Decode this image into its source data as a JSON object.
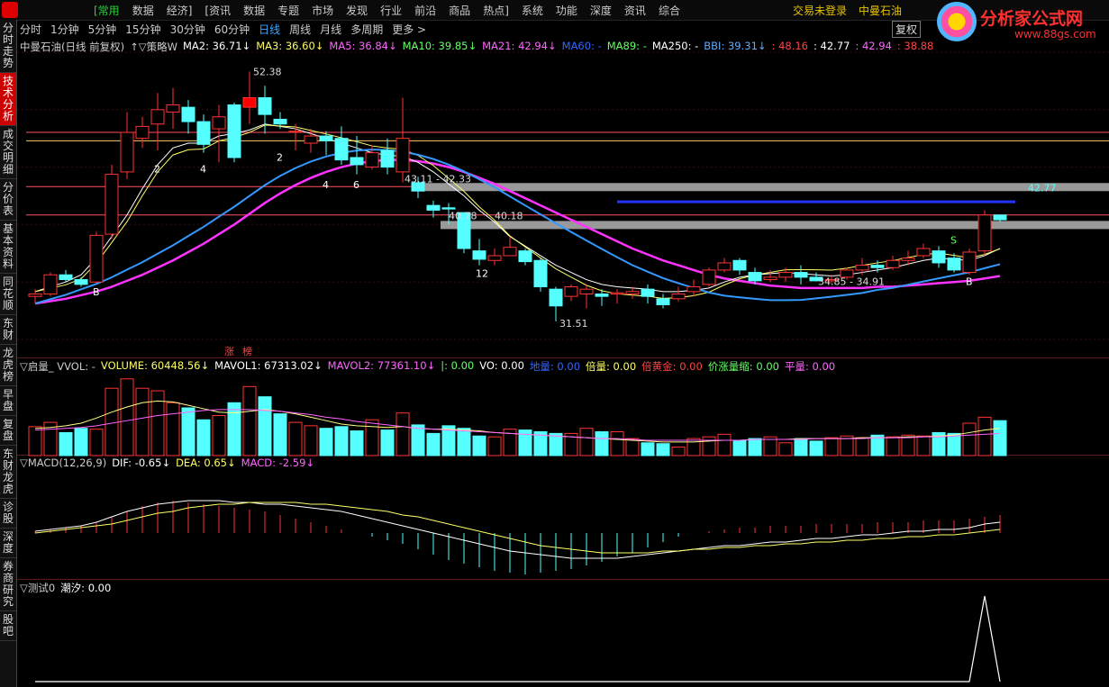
{
  "app": {
    "menu": [
      "[常用",
      "数据",
      "经济]",
      "[资讯",
      "数据",
      "专题",
      "市场",
      "发现",
      "行业",
      "前沿",
      "商品",
      "热点]",
      "系统",
      "功能",
      "深度",
      "资讯",
      "综合"
    ],
    "login": "交易未登录",
    "stock_name": "中曼石油",
    "brand_name": "分析家公式网",
    "brand_url": "www.88gs.com"
  },
  "sidebar": [
    "分时走势",
    "技术分析",
    "成交明细",
    "分价表",
    "基本资料",
    "同花顺",
    "东财",
    "龙虎榜",
    "早盘",
    "复盘",
    "东财龙虎",
    "诊股",
    "深度",
    "券商研究",
    "股吧"
  ],
  "periods": [
    "分时",
    "1分钟",
    "5分钟",
    "15分钟",
    "30分钟",
    "60分钟",
    "日线",
    "周线",
    "月线",
    "多周期",
    "更多 >"
  ],
  "active_period": "日线",
  "fuquan_label": "复权",
  "main_legend": [
    {
      "t": "中曼石油(日线 前复权)",
      "c": "#cccccc"
    },
    {
      "t": "↑▽策略W",
      "c": "#cccccc"
    },
    {
      "t": "MA2: 36.71↓",
      "c": "#ffffff"
    },
    {
      "t": "MA3: 36.60↓",
      "c": "#ffff66"
    },
    {
      "t": "MA5: 36.84↓",
      "c": "#ff66ff"
    },
    {
      "t": "MA10: 39.85↓",
      "c": "#66ff66"
    },
    {
      "t": "MA21: 42.94↓",
      "c": "#ff66ff"
    },
    {
      "t": "MA60: -",
      "c": "#3366ff"
    },
    {
      "t": "MA89: -",
      "c": "#66ff66"
    },
    {
      "t": "MA250: -",
      "c": "#ffffff"
    },
    {
      "t": "BBI: 39.31↓",
      "c": "#66aaff"
    },
    {
      "t": ": 48.16",
      "c": "#ff4444"
    },
    {
      "t": ": 42.77",
      "c": "#ffffff"
    },
    {
      "t": ": 42.94",
      "c": "#ff66ff"
    },
    {
      "t": ": 38.88",
      "c": "#ff4444"
    }
  ],
  "vol_legend": [
    {
      "t": "▽启量_ VVOL: -",
      "c": "#cccccc"
    },
    {
      "t": "VOLUME: 60448.56↓",
      "c": "#ffff66"
    },
    {
      "t": "MAVOL1: 67313.02↓",
      "c": "#ffffff"
    },
    {
      "t": "MAVOL2: 77361.10↓",
      "c": "#ff66ff"
    },
    {
      "t": "|: 0.00",
      "c": "#66ff66"
    },
    {
      "t": "VO: 0.00",
      "c": "#ffffff"
    },
    {
      "t": "地量: 0.00",
      "c": "#3366ff"
    },
    {
      "t": "倍量: 0.00",
      "c": "#ffff66"
    },
    {
      "t": "倍黄金: 0.00",
      "c": "#ff4444"
    },
    {
      "t": "价涨量缩: 0.00",
      "c": "#66ff66"
    },
    {
      "t": "平量: 0.00",
      "c": "#ff66ff"
    }
  ],
  "macd_legend": [
    {
      "t": "▽MACD(12,26,9)",
      "c": "#cccccc"
    },
    {
      "t": "DIF: -0.65↓",
      "c": "#ffffff"
    },
    {
      "t": "DEA: 0.65↓",
      "c": "#ffff66"
    },
    {
      "t": "MACD: -2.59↓",
      "c": "#ff66ff"
    }
  ],
  "test_legend": [
    {
      "t": "▽测试0",
      "c": "#cccccc"
    },
    {
      "t": "潮汐: 0.00",
      "c": "#ffffff"
    }
  ],
  "annotations": [
    "52.38",
    "43.11 - 42.33",
    "40.78",
    "40.18",
    "31.51",
    "34.85 - 34.91",
    "42.77",
    "2",
    "4",
    "2",
    "4",
    "6",
    "12",
    "B",
    "S",
    "B"
  ],
  "limit_up_labels": [
    "涨",
    "榜"
  ],
  "chart_data": [
    {
      "type": "candlestick",
      "title": "中曼石油(日线 前复权)",
      "ylim": [
        30,
        54
      ],
      "candles": [
        [
          33.6,
          33.8,
          33.0,
          34.2
        ],
        [
          33.8,
          35.4,
          33.6,
          35.6
        ],
        [
          35.4,
          35.0,
          34.8,
          35.8
        ],
        [
          35.0,
          34.6,
          34.4,
          35.2
        ],
        [
          34.8,
          38.7,
          34.7,
          39.0
        ],
        [
          38.8,
          43.8,
          38.4,
          44.6
        ],
        [
          44.0,
          47.3,
          43.4,
          49.0
        ],
        [
          46.8,
          47.8,
          46.0,
          48.6
        ],
        [
          48.0,
          49.2,
          45.8,
          50.6
        ],
        [
          49.0,
          49.6,
          47.6,
          51.0
        ],
        [
          49.4,
          48.2,
          47.2,
          50.0
        ],
        [
          48.2,
          46.3,
          45.6,
          48.8
        ],
        [
          47.6,
          48.6,
          44.8,
          49.6
        ],
        [
          49.6,
          45.2,
          44.8,
          49.8
        ],
        [
          49.4,
          50.2,
          48.0,
          52.38
        ],
        [
          50.2,
          48.8,
          47.2,
          51.2
        ],
        [
          48.4,
          48.0,
          47.6,
          49.0
        ],
        [
          47.4,
          47.4,
          45.8,
          48.0
        ],
        [
          46.4,
          47.0,
          45.6,
          47.6
        ],
        [
          47.0,
          46.6,
          45.4,
          47.4
        ],
        [
          46.8,
          45.0,
          44.6,
          47.8
        ],
        [
          45.2,
          44.6,
          43.8,
          47.0
        ],
        [
          44.4,
          45.6,
          44.2,
          46.2
        ],
        [
          45.8,
          44.4,
          43.8,
          46.8
        ],
        [
          44.0,
          46.8,
          43.11,
          50.2
        ],
        [
          43.1,
          42.4,
          41.8,
          43.6
        ],
        [
          41.2,
          40.8,
          40.18,
          41.6
        ],
        [
          41.0,
          40.9,
          39.6,
          41.4
        ],
        [
          40.6,
          37.6,
          37.2,
          40.6
        ],
        [
          37.4,
          36.7,
          36.2,
          38.4
        ],
        [
          36.6,
          37.0,
          36.2,
          37.6
        ],
        [
          37.0,
          37.7,
          37.0,
          38.6
        ],
        [
          37.4,
          36.5,
          36.2,
          37.6
        ],
        [
          36.6,
          34.4,
          34.0,
          36.8
        ],
        [
          34.2,
          32.8,
          31.51,
          34.4
        ],
        [
          33.6,
          34.4,
          33.2,
          34.6
        ],
        [
          33.8,
          34.2,
          32.6,
          34.6
        ],
        [
          33.8,
          33.6,
          32.8,
          34.2
        ],
        [
          33.8,
          33.9,
          33.0,
          34.2
        ],
        [
          33.8,
          34.0,
          33.4,
          34.4
        ],
        [
          34.2,
          33.6,
          33.0,
          34.6
        ],
        [
          33.4,
          32.9,
          32.6,
          33.8
        ],
        [
          33.4,
          33.8,
          33.2,
          34.4
        ],
        [
          34.0,
          34.4,
          33.6,
          35.0
        ],
        [
          34.6,
          35.8,
          34.4,
          36.0
        ],
        [
          35.8,
          36.4,
          35.6,
          36.8
        ],
        [
          36.6,
          35.8,
          35.4,
          36.8
        ],
        [
          35.6,
          34.9,
          34.6,
          36.0
        ],
        [
          35.0,
          35.2,
          34.8,
          35.8
        ],
        [
          35.2,
          35.6,
          34.8,
          36.0
        ],
        [
          35.6,
          35.2,
          34.6,
          36.2
        ],
        [
          35.2,
          34.9,
          34.85,
          35.6
        ],
        [
          34.9,
          35.0,
          34.7,
          35.4
        ],
        [
          35.2,
          35.8,
          35.0,
          36.0
        ],
        [
          35.8,
          36.2,
          35.4,
          36.8
        ],
        [
          36.2,
          36.0,
          35.6,
          36.6
        ],
        [
          36.0,
          36.6,
          35.8,
          37.0
        ],
        [
          36.6,
          36.8,
          36.2,
          37.4
        ],
        [
          37.0,
          37.6,
          36.8,
          38.0
        ],
        [
          37.4,
          36.4,
          36.0,
          37.8
        ],
        [
          36.8,
          35.8,
          35.6,
          37.2
        ],
        [
          35.6,
          37.3,
          35.4,
          37.6
        ],
        [
          37.4,
          40.4,
          37.0,
          40.8
        ],
        [
          40.4,
          40.0,
          39.8,
          40.4
        ]
      ],
      "limit_levels": [
        47.3,
        46.6,
        42.77,
        40.4
      ],
      "ma_points": {
        "MA5": [
          34.0,
          34.4,
          34.8,
          35.4,
          36.8,
          38.6,
          40.4,
          42.6,
          44.6,
          46.0,
          46.4,
          46.4,
          47.0,
          47.2,
          47.5,
          48.0,
          47.8,
          47.6,
          47.2,
          46.8,
          46.4,
          46.0,
          45.6,
          45.4,
          45.3,
          44.8,
          44.0,
          43.0,
          42.0,
          40.8,
          39.8,
          38.6,
          37.8,
          37.0,
          36.2,
          35.6,
          35.0,
          34.6,
          34.4,
          34.3,
          34.2,
          34.0,
          34.0,
          34.1,
          34.3,
          34.8,
          35.2,
          35.4,
          35.5,
          35.6,
          35.5,
          35.4,
          35.3,
          35.4,
          35.6,
          35.8,
          36.0,
          36.3,
          36.6,
          36.8,
          36.7,
          36.6,
          37.0,
          37.6
        ],
        "MA21": [
          33.0,
          33.2,
          33.4,
          33.7,
          34.0,
          34.4,
          34.9,
          35.4,
          36.0,
          36.6,
          37.3,
          38.0,
          38.8,
          39.6,
          40.5,
          41.4,
          42.2,
          42.9,
          43.5,
          44.0,
          44.4,
          44.7,
          44.9,
          45.0,
          45.0,
          44.9,
          44.7,
          44.4,
          44.0,
          43.5,
          43.0,
          42.4,
          41.8,
          41.2,
          40.6,
          40.0,
          39.4,
          38.8,
          38.2,
          37.6,
          37.1,
          36.6,
          36.2,
          35.8,
          35.4,
          35.1,
          34.9,
          34.7,
          34.5,
          34.4,
          34.3,
          34.3,
          34.3,
          34.3,
          34.3,
          34.4,
          34.4,
          34.5,
          34.6,
          34.7,
          34.8,
          34.9,
          35.1,
          35.3
        ]
      },
      "blue_level": 41.5
    },
    {
      "type": "bar",
      "title": "启量_ VVOL",
      "values": [
        3.4,
        3.9,
        2.7,
        3.2,
        3.1,
        7.9,
        9.0,
        7.9,
        7.6,
        6.2,
        5.6,
        4.2,
        4.7,
        6.2,
        8.1,
        6.9,
        4.9,
        3.9,
        3.5,
        3.2,
        3.4,
        2.9,
        4.2,
        3.0,
        5.0,
        3.6,
        2.6,
        3.5,
        3.2,
        2.3,
        2.2,
        3.1,
        3.0,
        2.8,
        2.6,
        2.6,
        3.2,
        2.8,
        2.8,
        2.0,
        1.5,
        1.4,
        1.0,
        2.0,
        2.2,
        2.5,
        1.8,
        2.0,
        2.2,
        1.5,
        2.0,
        1.7,
        2.1,
        2.3,
        2.1,
        2.4,
        2.2,
        2.4,
        2.3,
        2.7,
        2.6,
        3.8,
        4.5,
        4.1
      ],
      "mavol1": [
        3.2,
        3.3,
        3.5,
        3.8,
        4.4,
        5.1,
        5.7,
        6.2,
        6.4,
        6.3,
        5.9,
        5.5,
        5.1,
        5.0,
        5.2,
        5.4,
        5.2,
        4.9,
        4.5,
        4.1,
        3.7,
        3.5,
        3.4,
        3.3,
        3.4,
        3.2,
        3.1,
        3.1,
        3.0,
        2.9,
        2.7,
        2.6,
        2.5,
        2.4,
        2.3,
        2.2,
        2.1,
        2.0,
        1.9,
        1.8,
        1.7,
        1.6,
        1.6,
        1.6,
        1.7,
        1.8,
        1.8,
        1.9,
        1.9,
        1.9,
        2.0,
        2.0,
        2.0,
        2.0,
        2.1,
        2.1,
        2.1,
        2.2,
        2.2,
        2.3,
        2.4,
        2.7,
        3.0,
        3.2
      ],
      "mavol2": [
        3.0,
        3.1,
        3.2,
        3.3,
        3.5,
        3.8,
        4.1,
        4.4,
        4.7,
        4.9,
        5.1,
        5.3,
        5.4,
        5.4,
        5.4,
        5.3,
        5.2,
        5.0,
        4.8,
        4.5,
        4.3,
        4.0,
        3.8,
        3.6,
        3.4,
        3.2,
        3.1,
        3.0,
        2.9,
        2.8,
        2.7,
        2.6,
        2.5,
        2.4,
        2.3,
        2.2,
        2.1,
        2.0,
        2.0,
        1.9,
        1.8,
        1.8,
        1.8,
        1.8,
        1.8,
        1.8,
        1.8,
        1.9,
        1.9,
        1.9,
        1.9,
        2.0,
        2.0,
        2.0,
        2.0,
        2.1,
        2.1,
        2.1,
        2.2,
        2.2,
        2.3,
        2.4,
        2.5,
        2.6
      ]
    },
    {
      "type": "bar",
      "title": "MACD(12,26,9)",
      "ylim": [
        -3,
        3
      ],
      "values": [
        0.1,
        0.2,
        0.3,
        0.4,
        0.6,
        0.9,
        1.2,
        1.5,
        1.7,
        1.8,
        1.7,
        1.6,
        1.5,
        1.4,
        1.3,
        1.2,
        1.0,
        0.8,
        0.6,
        0.4,
        0.2,
        0.0,
        -0.2,
        -0.4,
        -0.6,
        -0.9,
        -1.2,
        -1.5,
        -1.7,
        -1.9,
        -2.1,
        -2.2,
        -2.3,
        -2.2,
        -2.1,
        -2.0,
        -1.8,
        -1.6,
        -1.3,
        -1.1,
        -0.8,
        -0.5,
        -0.2,
        0.0,
        0.1,
        0.2,
        0.3,
        0.3,
        0.4,
        0.4,
        0.4,
        0.5,
        0.5,
        0.5,
        0.5,
        0.6,
        0.6,
        0.6,
        0.7,
        0.7,
        0.7,
        0.8,
        0.9,
        1.0
      ],
      "dif": [
        0.1,
        0.2,
        0.3,
        0.4,
        0.6,
        0.9,
        1.2,
        1.4,
        1.6,
        1.7,
        1.8,
        1.8,
        1.8,
        1.7,
        1.7,
        1.6,
        1.6,
        1.5,
        1.4,
        1.3,
        1.2,
        1.0,
        0.8,
        0.6,
        0.4,
        0.2,
        0.0,
        -0.2,
        -0.4,
        -0.6,
        -0.8,
        -1.0,
        -1.1,
        -1.2,
        -1.3,
        -1.4,
        -1.4,
        -1.4,
        -1.4,
        -1.3,
        -1.2,
        -1.1,
        -1.0,
        -0.9,
        -0.8,
        -0.7,
        -0.7,
        -0.6,
        -0.5,
        -0.5,
        -0.4,
        -0.3,
        -0.3,
        -0.2,
        -0.1,
        -0.1,
        0.0,
        0.1,
        0.1,
        0.2,
        0.2,
        0.3,
        0.5,
        0.6
      ],
      "dea": [
        0.0,
        0.1,
        0.2,
        0.3,
        0.4,
        0.5,
        0.7,
        0.9,
        1.1,
        1.2,
        1.4,
        1.5,
        1.6,
        1.6,
        1.7,
        1.7,
        1.7,
        1.7,
        1.6,
        1.6,
        1.5,
        1.4,
        1.3,
        1.2,
        1.0,
        0.9,
        0.7,
        0.5,
        0.3,
        0.1,
        -0.1,
        -0.3,
        -0.5,
        -0.7,
        -0.8,
        -0.9,
        -1.0,
        -1.1,
        -1.1,
        -1.1,
        -1.1,
        -1.0,
        -1.0,
        -0.9,
        -0.9,
        -0.8,
        -0.8,
        -0.7,
        -0.7,
        -0.6,
        -0.6,
        -0.5,
        -0.5,
        -0.4,
        -0.4,
        -0.3,
        -0.3,
        -0.2,
        -0.2,
        -0.1,
        -0.1,
        0.0,
        0.1,
        0.2
      ]
    },
    {
      "type": "line",
      "title": "测试0",
      "values": [
        0,
        0,
        0,
        0,
        0,
        0,
        0,
        0,
        0,
        0,
        0,
        0,
        0,
        0,
        0,
        0,
        0,
        0,
        0,
        0,
        0,
        0,
        0,
        0,
        0,
        0,
        0,
        0,
        0,
        0,
        0,
        0,
        0,
        0,
        0,
        0,
        0,
        0,
        0,
        0,
        0,
        0,
        0,
        0,
        0,
        0,
        0,
        0,
        0,
        0,
        0,
        0,
        0,
        0,
        0,
        0,
        0,
        0,
        0,
        0,
        0,
        0,
        1,
        0
      ]
    }
  ]
}
